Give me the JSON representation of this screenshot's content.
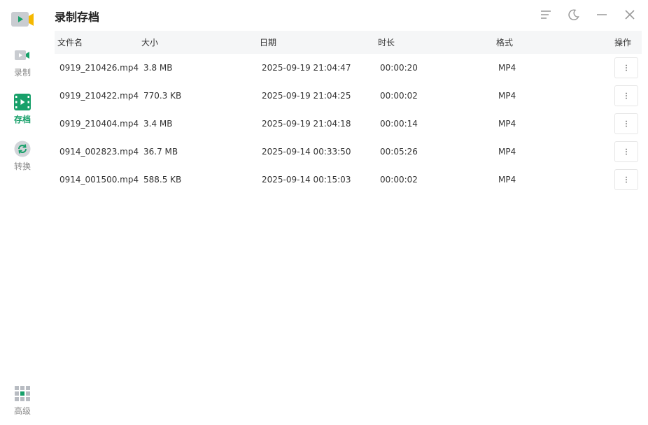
{
  "app": {
    "title": "录制存档"
  },
  "sidebar": {
    "items": [
      {
        "label": "录制",
        "icon": "camera-icon",
        "active": false
      },
      {
        "label": "存档",
        "icon": "film-icon",
        "active": true
      },
      {
        "label": "转换",
        "icon": "convert-icon",
        "active": false
      }
    ],
    "advanced": {
      "label": "高级",
      "icon": "grid-icon"
    }
  },
  "window": {
    "controls": [
      "menu-icon",
      "moon-icon",
      "minimize-icon",
      "close-icon"
    ]
  },
  "table": {
    "headers": {
      "name": "文件名",
      "size": "大小",
      "date": "日期",
      "duration": "时长",
      "format": "格式",
      "actions": "操作"
    },
    "rows": [
      {
        "name": "0919_210426.mp4",
        "size": "3.8 MB",
        "date": "2025-09-19 21:04:47",
        "duration": "00:00:20",
        "format": "MP4"
      },
      {
        "name": "0919_210422.mp4",
        "size": "770.3 KB",
        "date": "2025-09-19 21:04:25",
        "duration": "00:00:02",
        "format": "MP4"
      },
      {
        "name": "0919_210404.mp4",
        "size": "3.4 MB",
        "date": "2025-09-19 21:04:18",
        "duration": "00:00:14",
        "format": "MP4"
      },
      {
        "name": "0914_002823.mp4",
        "size": "36.7 MB",
        "date": "2025-09-14 00:33:50",
        "duration": "00:05:26",
        "format": "MP4"
      },
      {
        "name": "0914_001500.mp4",
        "size": "588.5 KB",
        "date": "2025-09-14 00:15:03",
        "duration": "00:00:02",
        "format": "MP4"
      }
    ]
  },
  "colors": {
    "accent": "#18a06a",
    "logo_yellow": "#f5b800",
    "icon_gray": "#b8bcc2"
  }
}
